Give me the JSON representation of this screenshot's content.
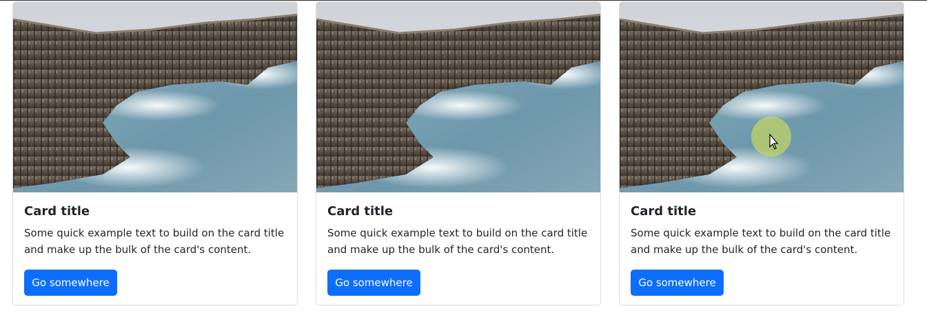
{
  "cards": [
    {
      "image_alt": "basalt cliffs by the sea",
      "title": "Card title",
      "text": "Some quick example text to build on the card title and make up the bulk of the card's content.",
      "button_label": "Go somewhere"
    },
    {
      "image_alt": "basalt cliffs by the sea",
      "title": "Card title",
      "text": "Some quick example text to build on the card title and make up the bulk of the card's content.",
      "button_label": "Go somewhere"
    },
    {
      "image_alt": "basalt cliffs by the sea",
      "title": "Card title",
      "text": "Some quick example text to build on the card title and make up the bulk of the card's content.",
      "button_label": "Go somewhere"
    }
  ],
  "colors": {
    "primary_button": "#0d6efd",
    "text": "#212529",
    "border": "#dcdcdc",
    "cursor_highlight": "#cddc5a"
  },
  "icons": {
    "cursor": "mouse-pointer-icon"
  }
}
